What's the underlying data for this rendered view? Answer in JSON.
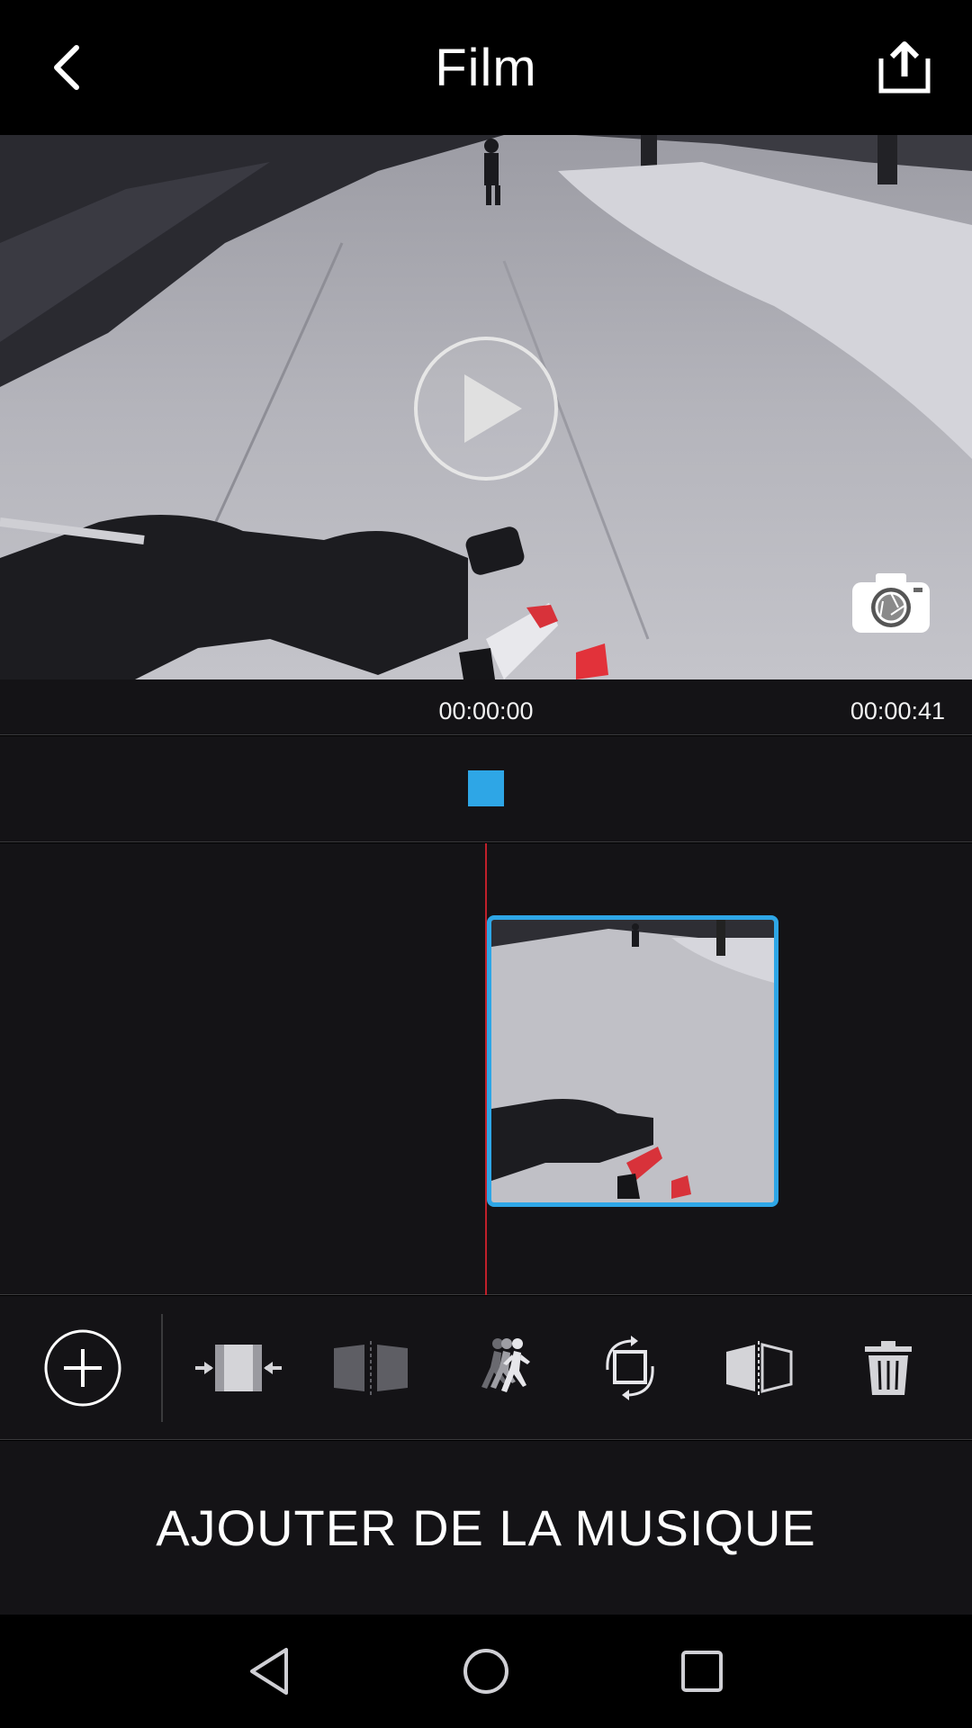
{
  "header": {
    "title": "Film",
    "back_icon": "chevron-left-icon",
    "share_icon": "share-upload-icon"
  },
  "preview": {
    "description_icon": "play-icon",
    "snapshot_icon": "camera-icon"
  },
  "timebar": {
    "current_time": "00:00:00",
    "total_time": "00:00:41"
  },
  "toolbar": {
    "tools": [
      {
        "icon": "add-circle-icon"
      },
      {
        "icon": "trim-icon"
      },
      {
        "icon": "split-icon"
      },
      {
        "icon": "speed-runner-icon"
      },
      {
        "icon": "rotate-crop-icon"
      },
      {
        "icon": "flip-icon"
      },
      {
        "icon": "trash-icon"
      }
    ]
  },
  "music": {
    "label": "AJOUTER DE LA MUSIQUE"
  },
  "navbar": {
    "items": [
      {
        "icon": "nav-back-triangle-icon"
      },
      {
        "icon": "nav-home-circle-icon"
      },
      {
        "icon": "nav-recents-square-icon"
      }
    ]
  },
  "colors": {
    "accent": "#2ea6e6",
    "playhead": "#c0202a",
    "background": "#141316"
  }
}
